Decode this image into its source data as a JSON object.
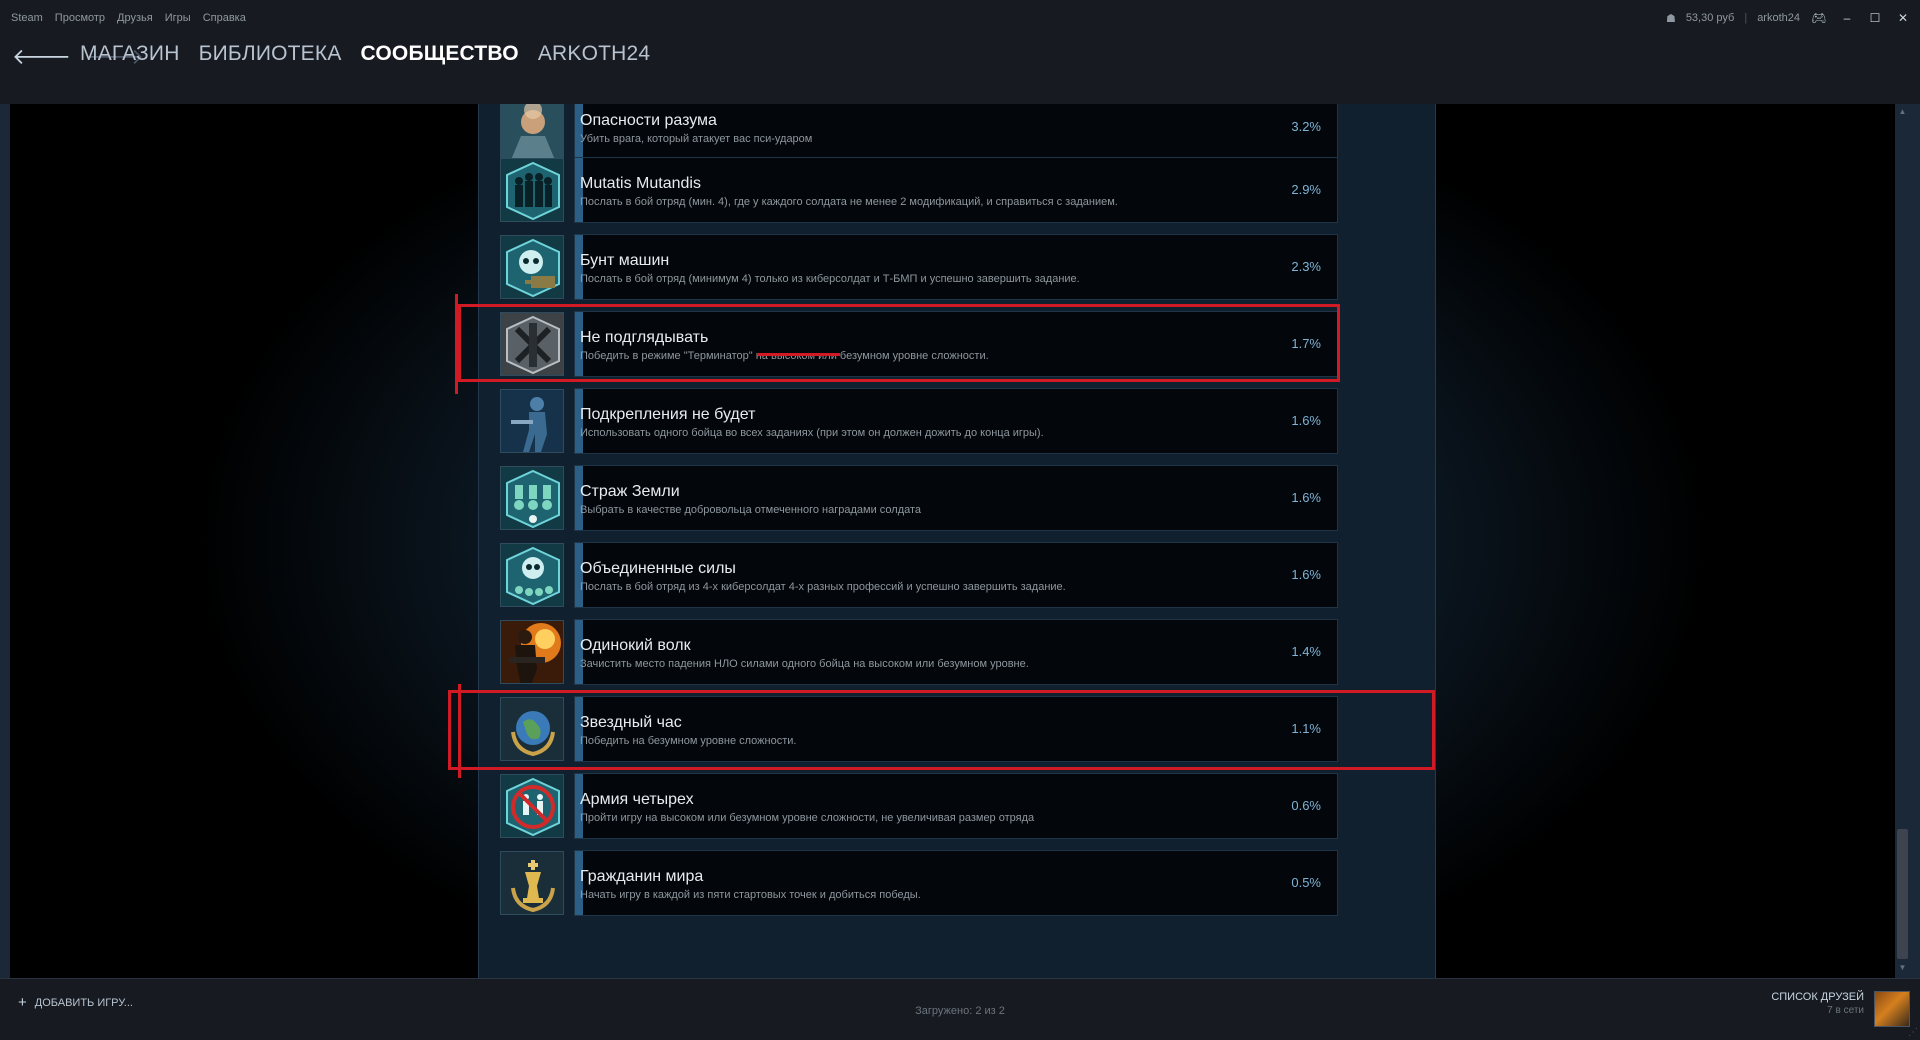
{
  "menu": [
    "Steam",
    "Просмотр",
    "Друзья",
    "Игры",
    "Справка"
  ],
  "system": {
    "balance": "53,30 руб",
    "user": "arkoth24"
  },
  "nav": {
    "tabs": [
      "МАГАЗИН",
      "БИБЛИОТЕКА",
      "СООБЩЕСТВО",
      "ARKOTH24"
    ],
    "active": "СООБЩЕСТВО"
  },
  "achievements": [
    {
      "name": "Опасности разума",
      "desc": "Убить врага, который атакует вас пси-ударом",
      "pct": "3.2%",
      "icon": "psi-soldier-icon"
    },
    {
      "name": "Mutatis Mutandis",
      "desc": "Послать в бой отряд (мин. 4), где у каждого солдата не менее 2 модификаций, и справиться с заданием.",
      "pct": "2.9%",
      "icon": "squad-icon"
    },
    {
      "name": "Бунт машин",
      "desc": "Послать в бой отряд (минимум 4) только из киберсолдат и Т-БМП и успешно завершить задание.",
      "pct": "2.3%",
      "icon": "skull-tank-icon"
    },
    {
      "name": "Не подглядывать",
      "desc": "Победить в режиме \"Терминатор\" на высоком или безумном уровне сложности.",
      "pct": "1.7%",
      "icon": "xcom-emblem-icon"
    },
    {
      "name": "Подкрепления не будет",
      "desc": "Использовать одного бойца во всех заданиях (при этом он должен дожить до конца игры).",
      "pct": "1.6%",
      "icon": "lone-soldier-icon"
    },
    {
      "name": "Страж Земли",
      "desc": "Выбрать в качестве добровольца отмеченного наградами солдата",
      "pct": "1.6%",
      "icon": "medals-icon"
    },
    {
      "name": "Объединенные силы",
      "desc": "Послать в бой отряд из 4-х киберсолдат 4-х разных профессий и успешно завершить задание.",
      "pct": "1.6%",
      "icon": "skull-mec-icon"
    },
    {
      "name": "Одинокий волк",
      "desc": "Зачистить место падения НЛО силами одного бойца на высоком или безумном уровне.",
      "pct": "1.4%",
      "icon": "fire-soldier-icon"
    },
    {
      "name": "Звездный час",
      "desc": "Победить на безумном уровне сложности.",
      "pct": "1.1%",
      "icon": "earth-laurel-icon"
    },
    {
      "name": "Армия четырех",
      "desc": "Пройти игру на высоком или безумном уровне сложности, не увеличивая размер отряда",
      "pct": "0.6%",
      "icon": "no-squad-icon"
    },
    {
      "name": "Гражданин мира",
      "desc": "Начать игру в каждой из пяти стартовых точек и добиться победы.",
      "pct": "0.5%",
      "icon": "chess-king-icon"
    }
  ],
  "footer": {
    "add_game": "ДОБАВИТЬ ИГРУ...",
    "loaded": "Загружено: 2 из 2",
    "friends_title": "СПИСОК ДРУЗЕЙ",
    "friends_online": "7 в сети"
  }
}
